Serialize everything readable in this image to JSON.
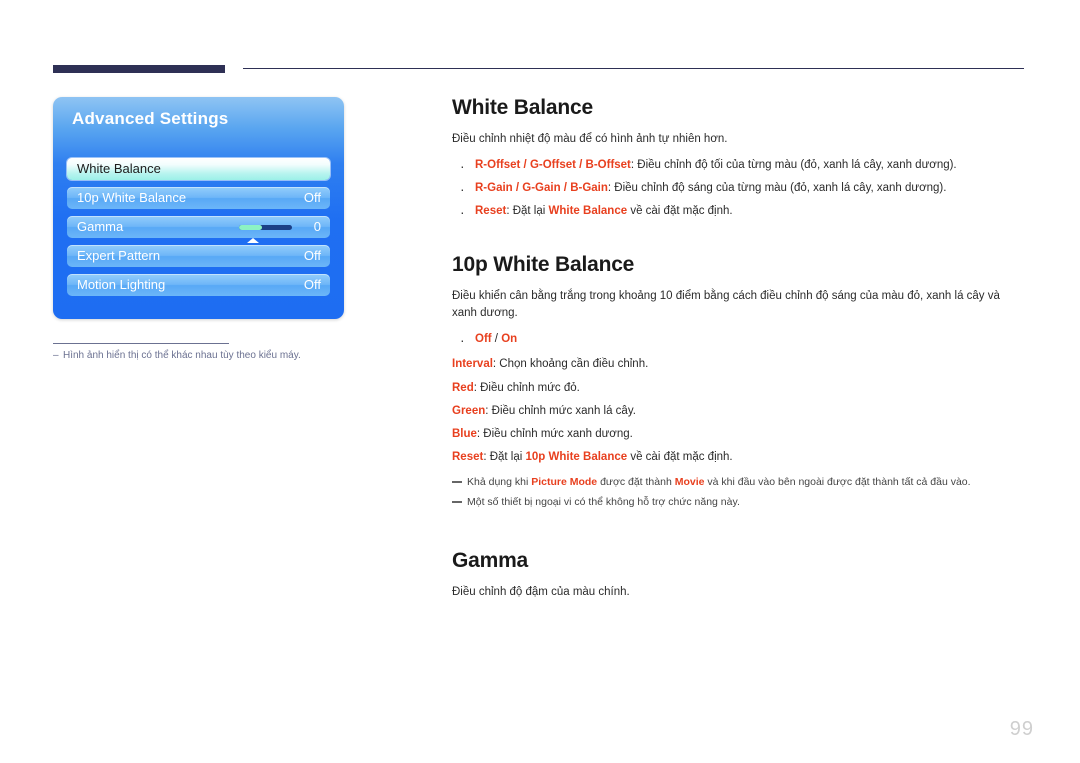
{
  "page": {
    "number": "99",
    "footnote_dash": "–",
    "footnote": "Hình ảnh hiển thị có thể khác nhau tùy theo kiểu máy."
  },
  "osd": {
    "title": "Advanced Settings",
    "rows": [
      {
        "label": "White Balance",
        "value": "",
        "selected": true,
        "slider": false
      },
      {
        "label": "10p White Balance",
        "value": "Off",
        "selected": false,
        "slider": false
      },
      {
        "label": "Gamma",
        "value": "0",
        "selected": false,
        "slider": true,
        "slider_fill_pct": 43
      },
      {
        "label": "Expert Pattern",
        "value": "Off",
        "selected": false,
        "slider": false
      },
      {
        "label": "Motion Lighting",
        "value": "Off",
        "selected": false,
        "slider": false
      }
    ]
  },
  "sections": {
    "white_balance": {
      "title": "White Balance",
      "lead": "Điều chỉnh nhiệt độ màu để có hình ảnh tự nhiên hơn.",
      "bullets": [
        {
          "key": "R-Offset / G-Offset / B-Offset",
          "text": ": Điều chỉnh độ tối của từng màu (đỏ, xanh lá cây, xanh dương)."
        },
        {
          "key": "R-Gain / G-Gain / B-Gain",
          "text": ": Điều chỉnh độ sáng của từng màu (đỏ, xanh lá cây, xanh dương)."
        },
        {
          "key": "Reset",
          "text": ": Đặt lại ",
          "key2": "White Balance",
          "text2": " về cài đặt mặc định."
        }
      ]
    },
    "tenp_white_balance": {
      "title": "10p White Balance",
      "lead": "Điều khiển cân bằng trắng trong khoảng 10 điểm bằng cách điều chỉnh độ sáng của màu đỏ, xanh lá cây và xanh dương.",
      "bullets": [
        {
          "key": "Off",
          "sep": " / ",
          "key2": "On"
        }
      ],
      "lines": [
        {
          "key": "Interval",
          "text": ": Chọn khoảng cần điều chỉnh."
        },
        {
          "key": "Red",
          "text": ": Điều chỉnh mức đỏ."
        },
        {
          "key": "Green",
          "text": ": Điều chỉnh mức xanh lá cây."
        },
        {
          "key": "Blue",
          "text": ": Điều chỉnh mức xanh dương."
        },
        {
          "key": "Reset",
          "text": ": Đặt lại ",
          "key2": "10p White Balance",
          "text2": " về cài đặt mặc định."
        }
      ],
      "notes": [
        {
          "a": "Khả dụng khi ",
          "k1": "Picture Mode",
          "b": " được đặt thành ",
          "k2": "Movie",
          "c": " và khi đầu vào bên ngoài được đặt thành tất cả đầu vào."
        },
        {
          "a": "Một số thiết bị ngoại vi có thể không hỗ trợ chức năng này.",
          "k1": "",
          "b": "",
          "k2": "",
          "c": ""
        }
      ]
    },
    "gamma": {
      "title": "Gamma",
      "lead": "Điều chỉnh độ đậm của màu chính."
    }
  },
  "colors": {
    "accent_red": "#e8401f",
    "header_navy": "#2e3055",
    "osd_blue": "#1e6df2",
    "page_gray": "#cfcfcf"
  }
}
